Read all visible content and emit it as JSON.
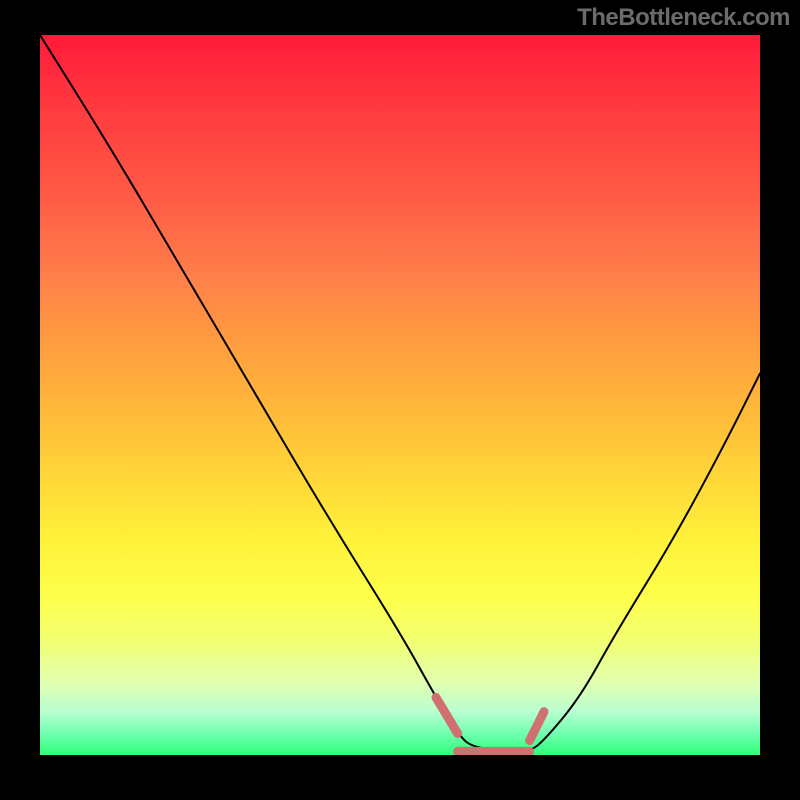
{
  "watermark": "TheBottleneck.com",
  "chart_data": {
    "type": "line",
    "title": "",
    "xlabel": "",
    "ylabel": "",
    "xlim": [
      0,
      100
    ],
    "ylim": [
      0,
      100
    ],
    "series": [
      {
        "name": "curve",
        "color": "#000000",
        "x": [
          0,
          10,
          20,
          30,
          40,
          50,
          55,
          58,
          60,
          66,
          68,
          70,
          75,
          80,
          88,
          95,
          100
        ],
        "values": [
          100,
          84,
          67,
          50,
          33,
          17,
          8,
          3,
          1,
          0.5,
          0.5,
          2,
          8,
          17,
          30,
          43,
          53
        ]
      },
      {
        "name": "highlight",
        "color": "#d07070",
        "segments": [
          {
            "x": [
              55,
              58
            ],
            "values": [
              8,
              3
            ]
          },
          {
            "x": [
              58,
              68
            ],
            "values": [
              0.5,
              0.5
            ]
          },
          {
            "x": [
              68,
              70
            ],
            "values": [
              2,
              6
            ]
          }
        ]
      }
    ],
    "legend": null,
    "grid": false,
    "background_gradient": {
      "stops": [
        {
          "pos": 0,
          "color": "#ff1a3a"
        },
        {
          "pos": 50,
          "color": "#ffb83a"
        },
        {
          "pos": 75,
          "color": "#fdff4a"
        },
        {
          "pos": 100,
          "color": "#2dff78"
        }
      ]
    }
  }
}
